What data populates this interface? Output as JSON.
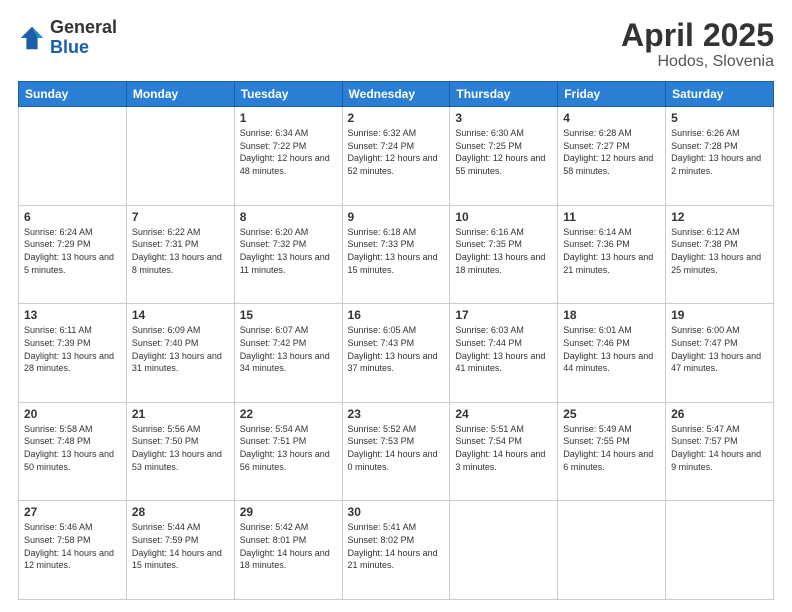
{
  "logo": {
    "general": "General",
    "blue": "Blue"
  },
  "title": {
    "month_year": "April 2025",
    "location": "Hodos, Slovenia"
  },
  "weekdays": [
    "Sunday",
    "Monday",
    "Tuesday",
    "Wednesday",
    "Thursday",
    "Friday",
    "Saturday"
  ],
  "weeks": [
    [
      {
        "day": "",
        "info": ""
      },
      {
        "day": "",
        "info": ""
      },
      {
        "day": "1",
        "info": "Sunrise: 6:34 AM\nSunset: 7:22 PM\nDaylight: 12 hours and 48 minutes."
      },
      {
        "day": "2",
        "info": "Sunrise: 6:32 AM\nSunset: 7:24 PM\nDaylight: 12 hours and 52 minutes."
      },
      {
        "day": "3",
        "info": "Sunrise: 6:30 AM\nSunset: 7:25 PM\nDaylight: 12 hours and 55 minutes."
      },
      {
        "day": "4",
        "info": "Sunrise: 6:28 AM\nSunset: 7:27 PM\nDaylight: 12 hours and 58 minutes."
      },
      {
        "day": "5",
        "info": "Sunrise: 6:26 AM\nSunset: 7:28 PM\nDaylight: 13 hours and 2 minutes."
      }
    ],
    [
      {
        "day": "6",
        "info": "Sunrise: 6:24 AM\nSunset: 7:29 PM\nDaylight: 13 hours and 5 minutes."
      },
      {
        "day": "7",
        "info": "Sunrise: 6:22 AM\nSunset: 7:31 PM\nDaylight: 13 hours and 8 minutes."
      },
      {
        "day": "8",
        "info": "Sunrise: 6:20 AM\nSunset: 7:32 PM\nDaylight: 13 hours and 11 minutes."
      },
      {
        "day": "9",
        "info": "Sunrise: 6:18 AM\nSunset: 7:33 PM\nDaylight: 13 hours and 15 minutes."
      },
      {
        "day": "10",
        "info": "Sunrise: 6:16 AM\nSunset: 7:35 PM\nDaylight: 13 hours and 18 minutes."
      },
      {
        "day": "11",
        "info": "Sunrise: 6:14 AM\nSunset: 7:36 PM\nDaylight: 13 hours and 21 minutes."
      },
      {
        "day": "12",
        "info": "Sunrise: 6:12 AM\nSunset: 7:38 PM\nDaylight: 13 hours and 25 minutes."
      }
    ],
    [
      {
        "day": "13",
        "info": "Sunrise: 6:11 AM\nSunset: 7:39 PM\nDaylight: 13 hours and 28 minutes."
      },
      {
        "day": "14",
        "info": "Sunrise: 6:09 AM\nSunset: 7:40 PM\nDaylight: 13 hours and 31 minutes."
      },
      {
        "day": "15",
        "info": "Sunrise: 6:07 AM\nSunset: 7:42 PM\nDaylight: 13 hours and 34 minutes."
      },
      {
        "day": "16",
        "info": "Sunrise: 6:05 AM\nSunset: 7:43 PM\nDaylight: 13 hours and 37 minutes."
      },
      {
        "day": "17",
        "info": "Sunrise: 6:03 AM\nSunset: 7:44 PM\nDaylight: 13 hours and 41 minutes."
      },
      {
        "day": "18",
        "info": "Sunrise: 6:01 AM\nSunset: 7:46 PM\nDaylight: 13 hours and 44 minutes."
      },
      {
        "day": "19",
        "info": "Sunrise: 6:00 AM\nSunset: 7:47 PM\nDaylight: 13 hours and 47 minutes."
      }
    ],
    [
      {
        "day": "20",
        "info": "Sunrise: 5:58 AM\nSunset: 7:48 PM\nDaylight: 13 hours and 50 minutes."
      },
      {
        "day": "21",
        "info": "Sunrise: 5:56 AM\nSunset: 7:50 PM\nDaylight: 13 hours and 53 minutes."
      },
      {
        "day": "22",
        "info": "Sunrise: 5:54 AM\nSunset: 7:51 PM\nDaylight: 13 hours and 56 minutes."
      },
      {
        "day": "23",
        "info": "Sunrise: 5:52 AM\nSunset: 7:53 PM\nDaylight: 14 hours and 0 minutes."
      },
      {
        "day": "24",
        "info": "Sunrise: 5:51 AM\nSunset: 7:54 PM\nDaylight: 14 hours and 3 minutes."
      },
      {
        "day": "25",
        "info": "Sunrise: 5:49 AM\nSunset: 7:55 PM\nDaylight: 14 hours and 6 minutes."
      },
      {
        "day": "26",
        "info": "Sunrise: 5:47 AM\nSunset: 7:57 PM\nDaylight: 14 hours and 9 minutes."
      }
    ],
    [
      {
        "day": "27",
        "info": "Sunrise: 5:46 AM\nSunset: 7:58 PM\nDaylight: 14 hours and 12 minutes."
      },
      {
        "day": "28",
        "info": "Sunrise: 5:44 AM\nSunset: 7:59 PM\nDaylight: 14 hours and 15 minutes."
      },
      {
        "day": "29",
        "info": "Sunrise: 5:42 AM\nSunset: 8:01 PM\nDaylight: 14 hours and 18 minutes."
      },
      {
        "day": "30",
        "info": "Sunrise: 5:41 AM\nSunset: 8:02 PM\nDaylight: 14 hours and 21 minutes."
      },
      {
        "day": "",
        "info": ""
      },
      {
        "day": "",
        "info": ""
      },
      {
        "day": "",
        "info": ""
      }
    ]
  ]
}
